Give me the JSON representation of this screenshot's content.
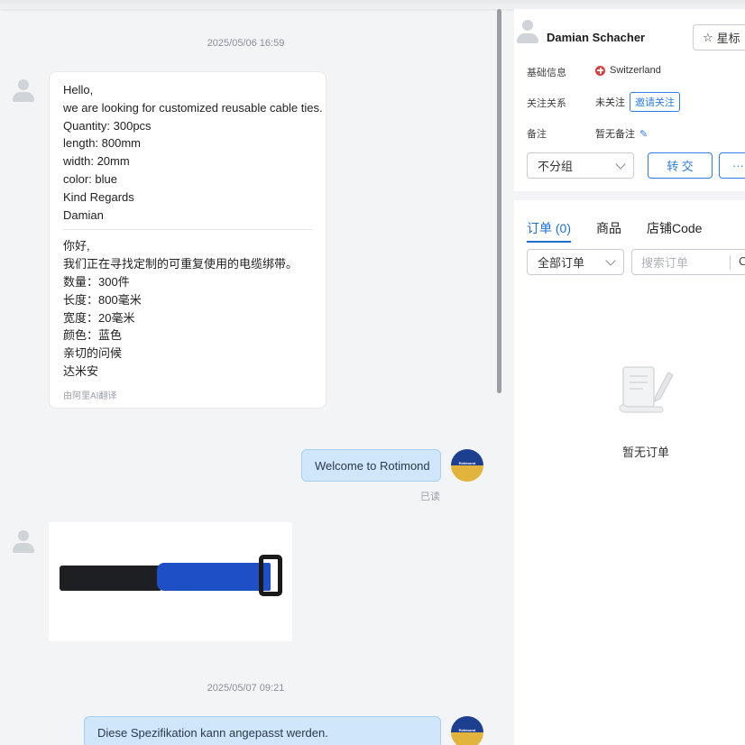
{
  "chat": {
    "timestamp_1": "2025/05/06 16:59",
    "incoming_message": {
      "lines": [
        "Hello,",
        "we are looking for customized reusable cable ties.",
        "Quantity: 300pcs",
        "length: 800mm",
        "width: 20mm",
        "color: blue",
        "Kind Regards",
        "Damian"
      ],
      "translated_lines": [
        "你好,",
        "我们正在寻找定制的可重复使用的电缆绑带。",
        "数量：300件",
        "长度：800毫米",
        "宽度：20毫米",
        "颜色：蓝色",
        "亲切的问候",
        "达米安"
      ],
      "translation_note": "由阿里AI翻译"
    },
    "outgoing_1": {
      "text": "Welcome to Rotimond",
      "status": "已读"
    },
    "brand_avatar_text": "Rotimond",
    "timestamp_2": "2025/05/07 09:21",
    "outgoing_2": {
      "text": "Diese Spezifikation kann angepasst werden."
    }
  },
  "contact": {
    "name": "Damian Schacher",
    "star_label": "星标",
    "basic_info_label": "基础信息",
    "country": "Switzerland",
    "follow_label": "关注关系",
    "follow_value": "未关注",
    "invite_label": "邀请关注",
    "note_label": "备注",
    "note_value": "暂无备注",
    "group_select": "不分组",
    "transfer_label": "转 交",
    "more_label": "···"
  },
  "orders": {
    "tabs": [
      {
        "label": "订单 (0)",
        "active": true
      },
      {
        "label": "商品",
        "active": false
      },
      {
        "label": "店铺Code",
        "active": false
      }
    ],
    "filter_select": "全部订单",
    "search_placeholder": "搜索订单",
    "search_trailing": "C",
    "empty_text": "暂无订单"
  },
  "colors": {
    "accent": "#2b7de0",
    "outgoing_bubble": "#cfe6fb",
    "brand_navy": "#1d3f8f",
    "brand_gold": "#e2b43c"
  }
}
